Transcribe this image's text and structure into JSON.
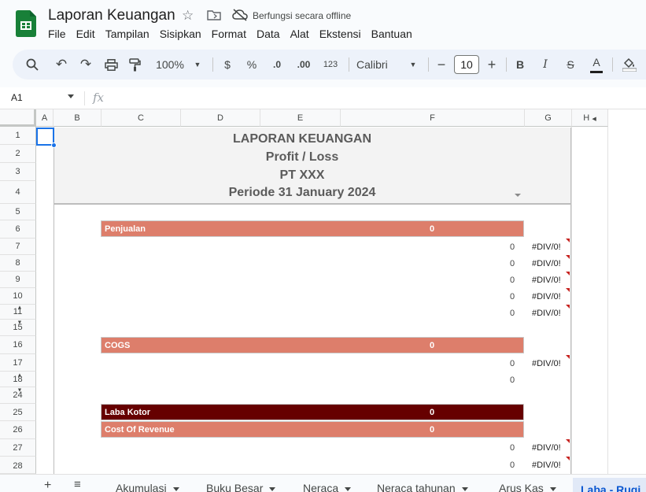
{
  "app": {
    "title": "Laporan Keuangan",
    "offline_status": "Berfungsi secara offline",
    "menu": [
      "File",
      "Edit",
      "Tampilan",
      "Sisipkan",
      "Format",
      "Data",
      "Alat",
      "Ekstensi",
      "Bantuan"
    ]
  },
  "toolbar": {
    "zoom": "100%",
    "currency": "$",
    "percent": "%",
    "decimal_decrease": ".0",
    "decimal_increase": ".00",
    "number_format": "123",
    "font": "Calibri",
    "font_size": "10",
    "bold": "B",
    "italic": "I",
    "strike": "S",
    "text_color": "A"
  },
  "formula_bar": {
    "cell_ref": "A1",
    "fx": "fx"
  },
  "columns": [
    "A",
    "B",
    "C",
    "D",
    "E",
    "F",
    "G",
    "H"
  ],
  "rows": [
    "1",
    "2",
    "3",
    "4",
    "5",
    "6",
    "7",
    "8",
    "9",
    "10",
    "11",
    "15",
    "16",
    "17",
    "18",
    "24",
    "25",
    "26",
    "27",
    "28"
  ],
  "report": {
    "title1": "LAPORAN KEUANGAN",
    "title2": "Profit / Loss",
    "title3": "PT XXX",
    "title4": "Periode 31 January 2024",
    "sections": [
      {
        "label": "Penjualan",
        "value": "0"
      },
      {
        "label": "COGS",
        "value": "0"
      },
      {
        "label": "Laba Kotor",
        "value": "0"
      },
      {
        "label": "Cost Of Revenue",
        "value": "0"
      }
    ],
    "zero": "0",
    "error": "#DIV/0!"
  },
  "sheets": [
    "Akumulasi",
    "Buku Besar",
    "Neraca",
    "Neraca tahunan",
    "Arus Kas",
    "Laba - Rugi"
  ],
  "colors": {
    "band_salmon": "#dd7e6b",
    "band_dark": "#660000",
    "selection": "#1a73e8",
    "logo_green": "#188038"
  }
}
